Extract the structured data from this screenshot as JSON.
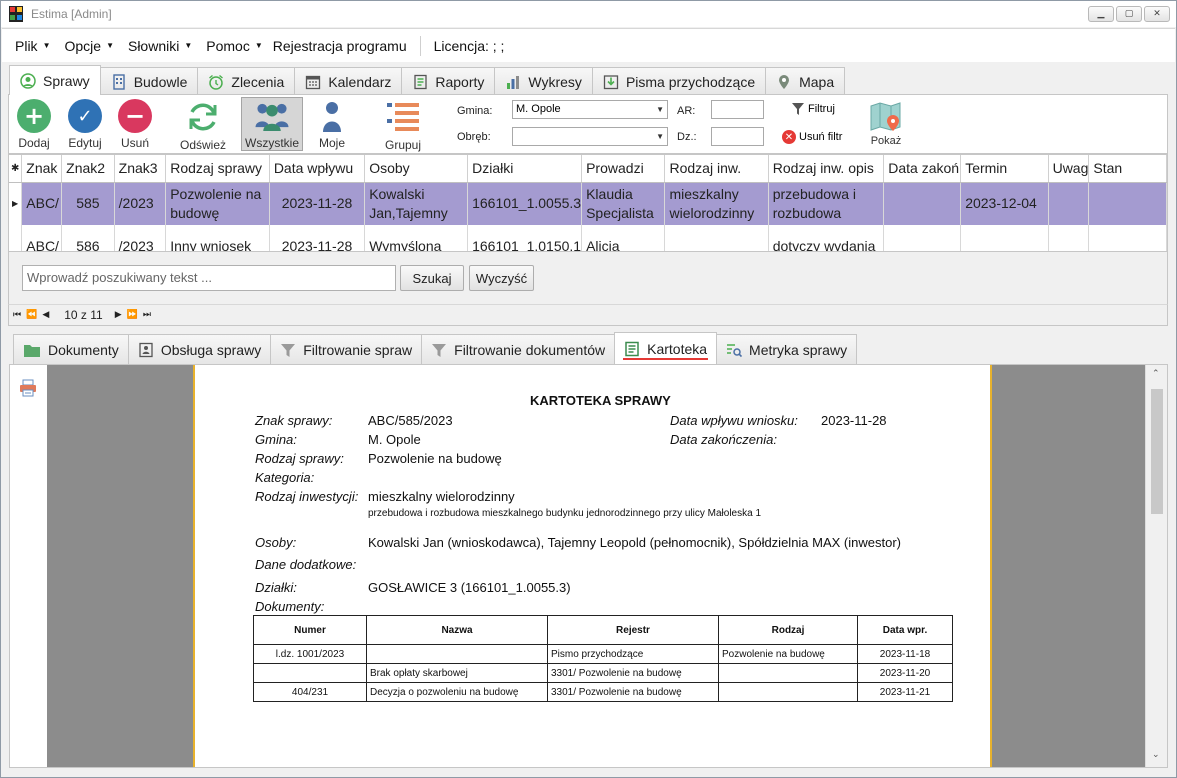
{
  "window": {
    "title": "Estima [Admin]"
  },
  "menu": {
    "items": [
      "Plik",
      "Opcje",
      "Słowniki",
      "Pomoc"
    ],
    "register": "Rejestracja programu",
    "license": "Licencja: ; ;"
  },
  "main_tabs": [
    "Sprawy",
    "Budowle",
    "Zlecenia",
    "Kalendarz",
    "Raporty",
    "Wykresy",
    "Pisma przychodzące",
    "Mapa"
  ],
  "toolbar": {
    "add": "Dodaj",
    "edit": "Edytuj",
    "delete": "Usuń",
    "refresh": "Odśwież",
    "all": "Wszystkie",
    "mine": "Moje",
    "group": "Grupuj",
    "gmina_label": "Gmina:",
    "gmina_value": "M. Opole",
    "obreb_label": "Obręb:",
    "obreb_value": "",
    "ar_label": "AR:",
    "dz_label": "Dz.:",
    "filter": "Filtruj",
    "clear_filter": "Usuń filtr",
    "show": "Pokaż"
  },
  "grid": {
    "columns": [
      "Znak",
      "Znak2",
      "Znak3",
      "Rodzaj sprawy",
      "Data wpływu",
      "Osoby",
      "Działki",
      "Prowadzi",
      "Rodzaj inw.",
      "Rodzaj inw. opis",
      "Data zakoń",
      "Termin",
      "Uwag",
      "Stan"
    ],
    "rows": [
      {
        "znak": "ABC/",
        "znak2": "585",
        "znak3": "/2023",
        "rodzaj": "Pozwolenie na budowę",
        "data": "2023-11-28",
        "osoby": "Kowalski Jan,Tajemny",
        "dzialki": "166101_1.0055.3",
        "prowadzi": "Klaudia Specjalista",
        "rinw": "mieszkalny wielorodzinny",
        "rinw_opis": "przebudowa i rozbudowa",
        "data_zak": "",
        "termin": "2023-12-04",
        "uwagi": "",
        "stan": ""
      },
      {
        "znak": "ABC/",
        "znak2": "586",
        "znak3": "/2023",
        "rodzaj": "Inny wniosek",
        "data": "2023-11-28",
        "osoby": "Wymyślona",
        "dzialki": "166101_1.0150.1",
        "prowadzi": "Alicja",
        "rinw": "",
        "rinw_opis": "dotyczy wydania",
        "data_zak": "",
        "termin": "",
        "uwagi": "",
        "stan": ""
      }
    ]
  },
  "search": {
    "placeholder": "Wprowadź poszukiwany tekst ...",
    "search_btn": "Szukaj",
    "clear_btn": "Wyczyść"
  },
  "pager": {
    "text": "10 z 11"
  },
  "bottom_tabs": [
    "Dokumenty",
    "Obsługa sprawy",
    "Filtrowanie spraw",
    "Filtrowanie dokumentów",
    "Kartoteka",
    "Metryka sprawy"
  ],
  "report": {
    "title": "KARTOTEKA SPRAWY",
    "znak_label": "Znak sprawy:",
    "znak_value": "ABC/585/2023",
    "data_wplywu_label": "Data wpływu wniosku:",
    "data_wplywu_value": "2023-11-28",
    "gmina_label": "Gmina:",
    "gmina_value": "M. Opole",
    "data_zak_label": "Data zakończenia:",
    "rodzaj_label": "Rodzaj sprawy:",
    "rodzaj_value": "Pozwolenie na budowę",
    "kategoria_label": "Kategoria:",
    "rinw_label": "Rodzaj inwestycji:",
    "rinw_value": "mieszkalny wielorodzinny",
    "rinw_opis": "przebudowa i rozbudowa mieszkalnego budynku jednorodzinnego przy ulicy Małoleska 1",
    "osoby_label": "Osoby:",
    "osoby_value": "Kowalski Jan (wnioskodawca), Tajemny Leopold (pełnomocnik), Spółdzielnia MAX (inwestor)",
    "dane_label": "Dane dodatkowe:",
    "dzialki_label": "Działki:",
    "dzialki_value": "GOSŁAWICE 3 (166101_1.0055.3)",
    "dokumenty_label": "Dokumenty:",
    "doc_columns": [
      "Numer",
      "Nazwa",
      "Rejestr",
      "Rodzaj",
      "Data wpr."
    ],
    "docs": [
      {
        "numer": "l.dz. 1001/2023",
        "nazwa": "",
        "rejestr": "Pismo przychodzące",
        "rodzaj": "Pozwolenie na budowę",
        "data": "2023-11-18"
      },
      {
        "numer": "",
        "nazwa": "Brak opłaty skarbowej",
        "rejestr": "3301/ Pozwolenie na budowę",
        "rodzaj": "",
        "data": "2023-11-20"
      },
      {
        "numer": "404/231",
        "nazwa": "Decyzja o pozwoleniu na budowę",
        "rejestr": "3301/ Pozwolenie na budowę",
        "rodzaj": "",
        "data": "2023-11-21"
      }
    ]
  },
  "colors": {
    "selected_row": "#a49bd0",
    "add": "#4cae6e",
    "edit": "#2f72b5",
    "delete": "#d9385f",
    "accent_border": "#e8b22c"
  }
}
